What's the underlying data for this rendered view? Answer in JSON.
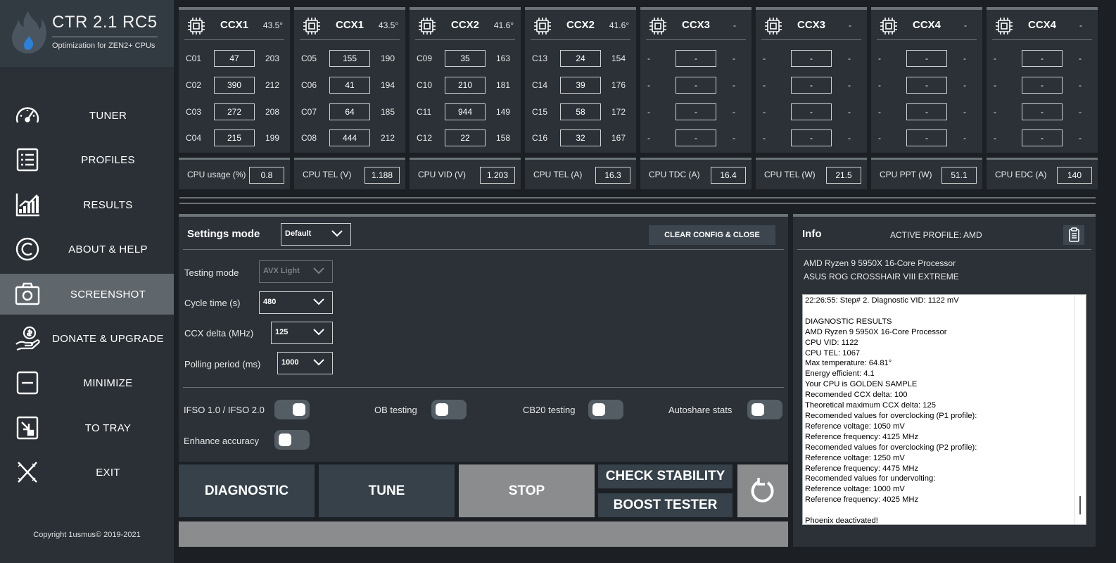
{
  "app": {
    "title": "CTR 2.1 RC5",
    "subtitle": "Optimization for ZEN2+ CPUs",
    "copyright": "Copyright 1usmus© 2019-2021"
  },
  "sidebar": {
    "items": [
      {
        "label": "TUNER",
        "icon": "speedometer-icon"
      },
      {
        "label": "PROFILES",
        "icon": "list-icon"
      },
      {
        "label": "RESULTS",
        "icon": "bar-chart-icon"
      },
      {
        "label": "ABOUT & HELP",
        "icon": "copyright-icon"
      },
      {
        "label": "SCREENSHOT",
        "icon": "camera-icon"
      },
      {
        "label": "DONATE & UPGRADE",
        "icon": "donate-hand-icon"
      },
      {
        "label": "MINIMIZE",
        "icon": "minimize-icon"
      },
      {
        "label": "TO TRAY",
        "icon": "tray-arrow-icon"
      },
      {
        "label": "EXIT",
        "icon": "close-x-icon"
      }
    ],
    "active": "SCREENSHOT"
  },
  "ccx": [
    {
      "name": "CCX1",
      "temp": "43.5°",
      "cores": [
        {
          "label": "C01",
          "value": "47",
          "freq": "203"
        },
        {
          "label": "C02",
          "value": "390",
          "freq": "212"
        },
        {
          "label": "C03",
          "value": "272",
          "freq": "208"
        },
        {
          "label": "C04",
          "value": "215",
          "freq": "199"
        }
      ]
    },
    {
      "name": "CCX1",
      "temp": "43.5°",
      "cores": [
        {
          "label": "C05",
          "value": "155",
          "freq": "190"
        },
        {
          "label": "C06",
          "value": "41",
          "freq": "194"
        },
        {
          "label": "C07",
          "value": "64",
          "freq": "185"
        },
        {
          "label": "C08",
          "value": "444",
          "freq": "212"
        }
      ]
    },
    {
      "name": "CCX2",
      "temp": "41.6°",
      "cores": [
        {
          "label": "C09",
          "value": "35",
          "freq": "163"
        },
        {
          "label": "C10",
          "value": "210",
          "freq": "181"
        },
        {
          "label": "C11",
          "value": "944",
          "freq": "149"
        },
        {
          "label": "C12",
          "value": "22",
          "freq": "158"
        }
      ]
    },
    {
      "name": "CCX2",
      "temp": "41.6°",
      "cores": [
        {
          "label": "C13",
          "value": "24",
          "freq": "154"
        },
        {
          "label": "C14",
          "value": "39",
          "freq": "176"
        },
        {
          "label": "C15",
          "value": "58",
          "freq": "172"
        },
        {
          "label": "C16",
          "value": "32",
          "freq": "167"
        }
      ]
    },
    {
      "name": "CCX3",
      "temp": "-",
      "cores": [
        {
          "label": "-",
          "value": "-",
          "freq": "-"
        },
        {
          "label": "-",
          "value": "-",
          "freq": "-"
        },
        {
          "label": "-",
          "value": "-",
          "freq": "-"
        },
        {
          "label": "-",
          "value": "-",
          "freq": "-"
        }
      ]
    },
    {
      "name": "CCX3",
      "temp": "-",
      "cores": [
        {
          "label": "-",
          "value": "-",
          "freq": "-"
        },
        {
          "label": "-",
          "value": "-",
          "freq": "-"
        },
        {
          "label": "-",
          "value": "-",
          "freq": "-"
        },
        {
          "label": "-",
          "value": "-",
          "freq": "-"
        }
      ]
    },
    {
      "name": "CCX4",
      "temp": "-",
      "cores": [
        {
          "label": "-",
          "value": "-",
          "freq": "-"
        },
        {
          "label": "-",
          "value": "-",
          "freq": "-"
        },
        {
          "label": "-",
          "value": "-",
          "freq": "-"
        },
        {
          "label": "-",
          "value": "-",
          "freq": "-"
        }
      ]
    },
    {
      "name": "CCX4",
      "temp": "-",
      "cores": [
        {
          "label": "-",
          "value": "-",
          "freq": "-"
        },
        {
          "label": "-",
          "value": "-",
          "freq": "-"
        },
        {
          "label": "-",
          "value": "-",
          "freq": "-"
        },
        {
          "label": "-",
          "value": "-",
          "freq": "-"
        }
      ]
    }
  ],
  "metrics": [
    {
      "label": "CPU usage (%)",
      "value": "0.8"
    },
    {
      "label": "CPU TEL (V)",
      "value": "1.188"
    },
    {
      "label": "CPU VID (V)",
      "value": "1.203"
    },
    {
      "label": "CPU TEL (A)",
      "value": "16.3"
    },
    {
      "label": "CPU TDC (A)",
      "value": "16.4"
    },
    {
      "label": "CPU TEL (W)",
      "value": "21.5"
    },
    {
      "label": "CPU PPT (W)",
      "value": "51.1"
    },
    {
      "label": "CPU EDC (A)",
      "value": "140"
    }
  ],
  "settings": {
    "title": "Settings mode",
    "mode_value": "Default",
    "clear_label": "CLEAR CONFIG & CLOSE",
    "testing_mode_label": "Testing mode",
    "testing_mode_value": "AVX Light",
    "cycle_time_label": "Cycle time (s)",
    "cycle_time_value": "480",
    "ccx_delta_label": "CCX delta (MHz)",
    "ccx_delta_value": "125",
    "polling_label": "Polling period (ms)",
    "polling_value": "1000",
    "toggles": {
      "ifso": {
        "label": "IFSO 1.0 / IFSO 2.0",
        "on": true
      },
      "ob": {
        "label": "OB testing",
        "on": false
      },
      "cb20": {
        "label": "CB20 testing",
        "on": false
      },
      "autoshare": {
        "label": "Autoshare stats",
        "on": false
      },
      "enhance": {
        "label": "Enhance accuracy",
        "on": false
      }
    }
  },
  "actions": {
    "diagnostic": "DIAGNOSTIC",
    "tune": "TUNE",
    "stop": "STOP",
    "check_stability": "CHECK STABILITY",
    "boost_tester": "BOOST TESTER"
  },
  "info": {
    "title": "Info",
    "active_profile": "ACTIVE PROFILE: AMD",
    "cpu": "AMD Ryzen 9 5950X 16-Core Processor",
    "board": "ASUS ROG CROSSHAIR VIII EXTREME",
    "log": "22:26:55: Step# 2. Diagnostic VID: 1122 mV\n\nDIAGNOSTIC RESULTS\nAMD Ryzen 9 5950X 16-Core Processor\nCPU VID: 1122\nCPU TEL: 1067\nMax temperature: 64.81°\nEnergy efficient: 4.1\nYour CPU is GOLDEN SAMPLE\nRecomended CCX delta: 100\nTheoretical maximum CCX delta: 125\nRecomended values for overclocking (P1 profile):\nReference voltage: 1050 mV\nReference frequency: 4125 MHz\nRecomended values for overclocking (P2 profile):\nReference voltage: 1250 mV\nReference frequency: 4475 MHz\nRecomended values for undervolting:\nReference voltage: 1000 mV\nReference frequency: 4025 MHz\n\nPhoenix deactivated!"
  }
}
